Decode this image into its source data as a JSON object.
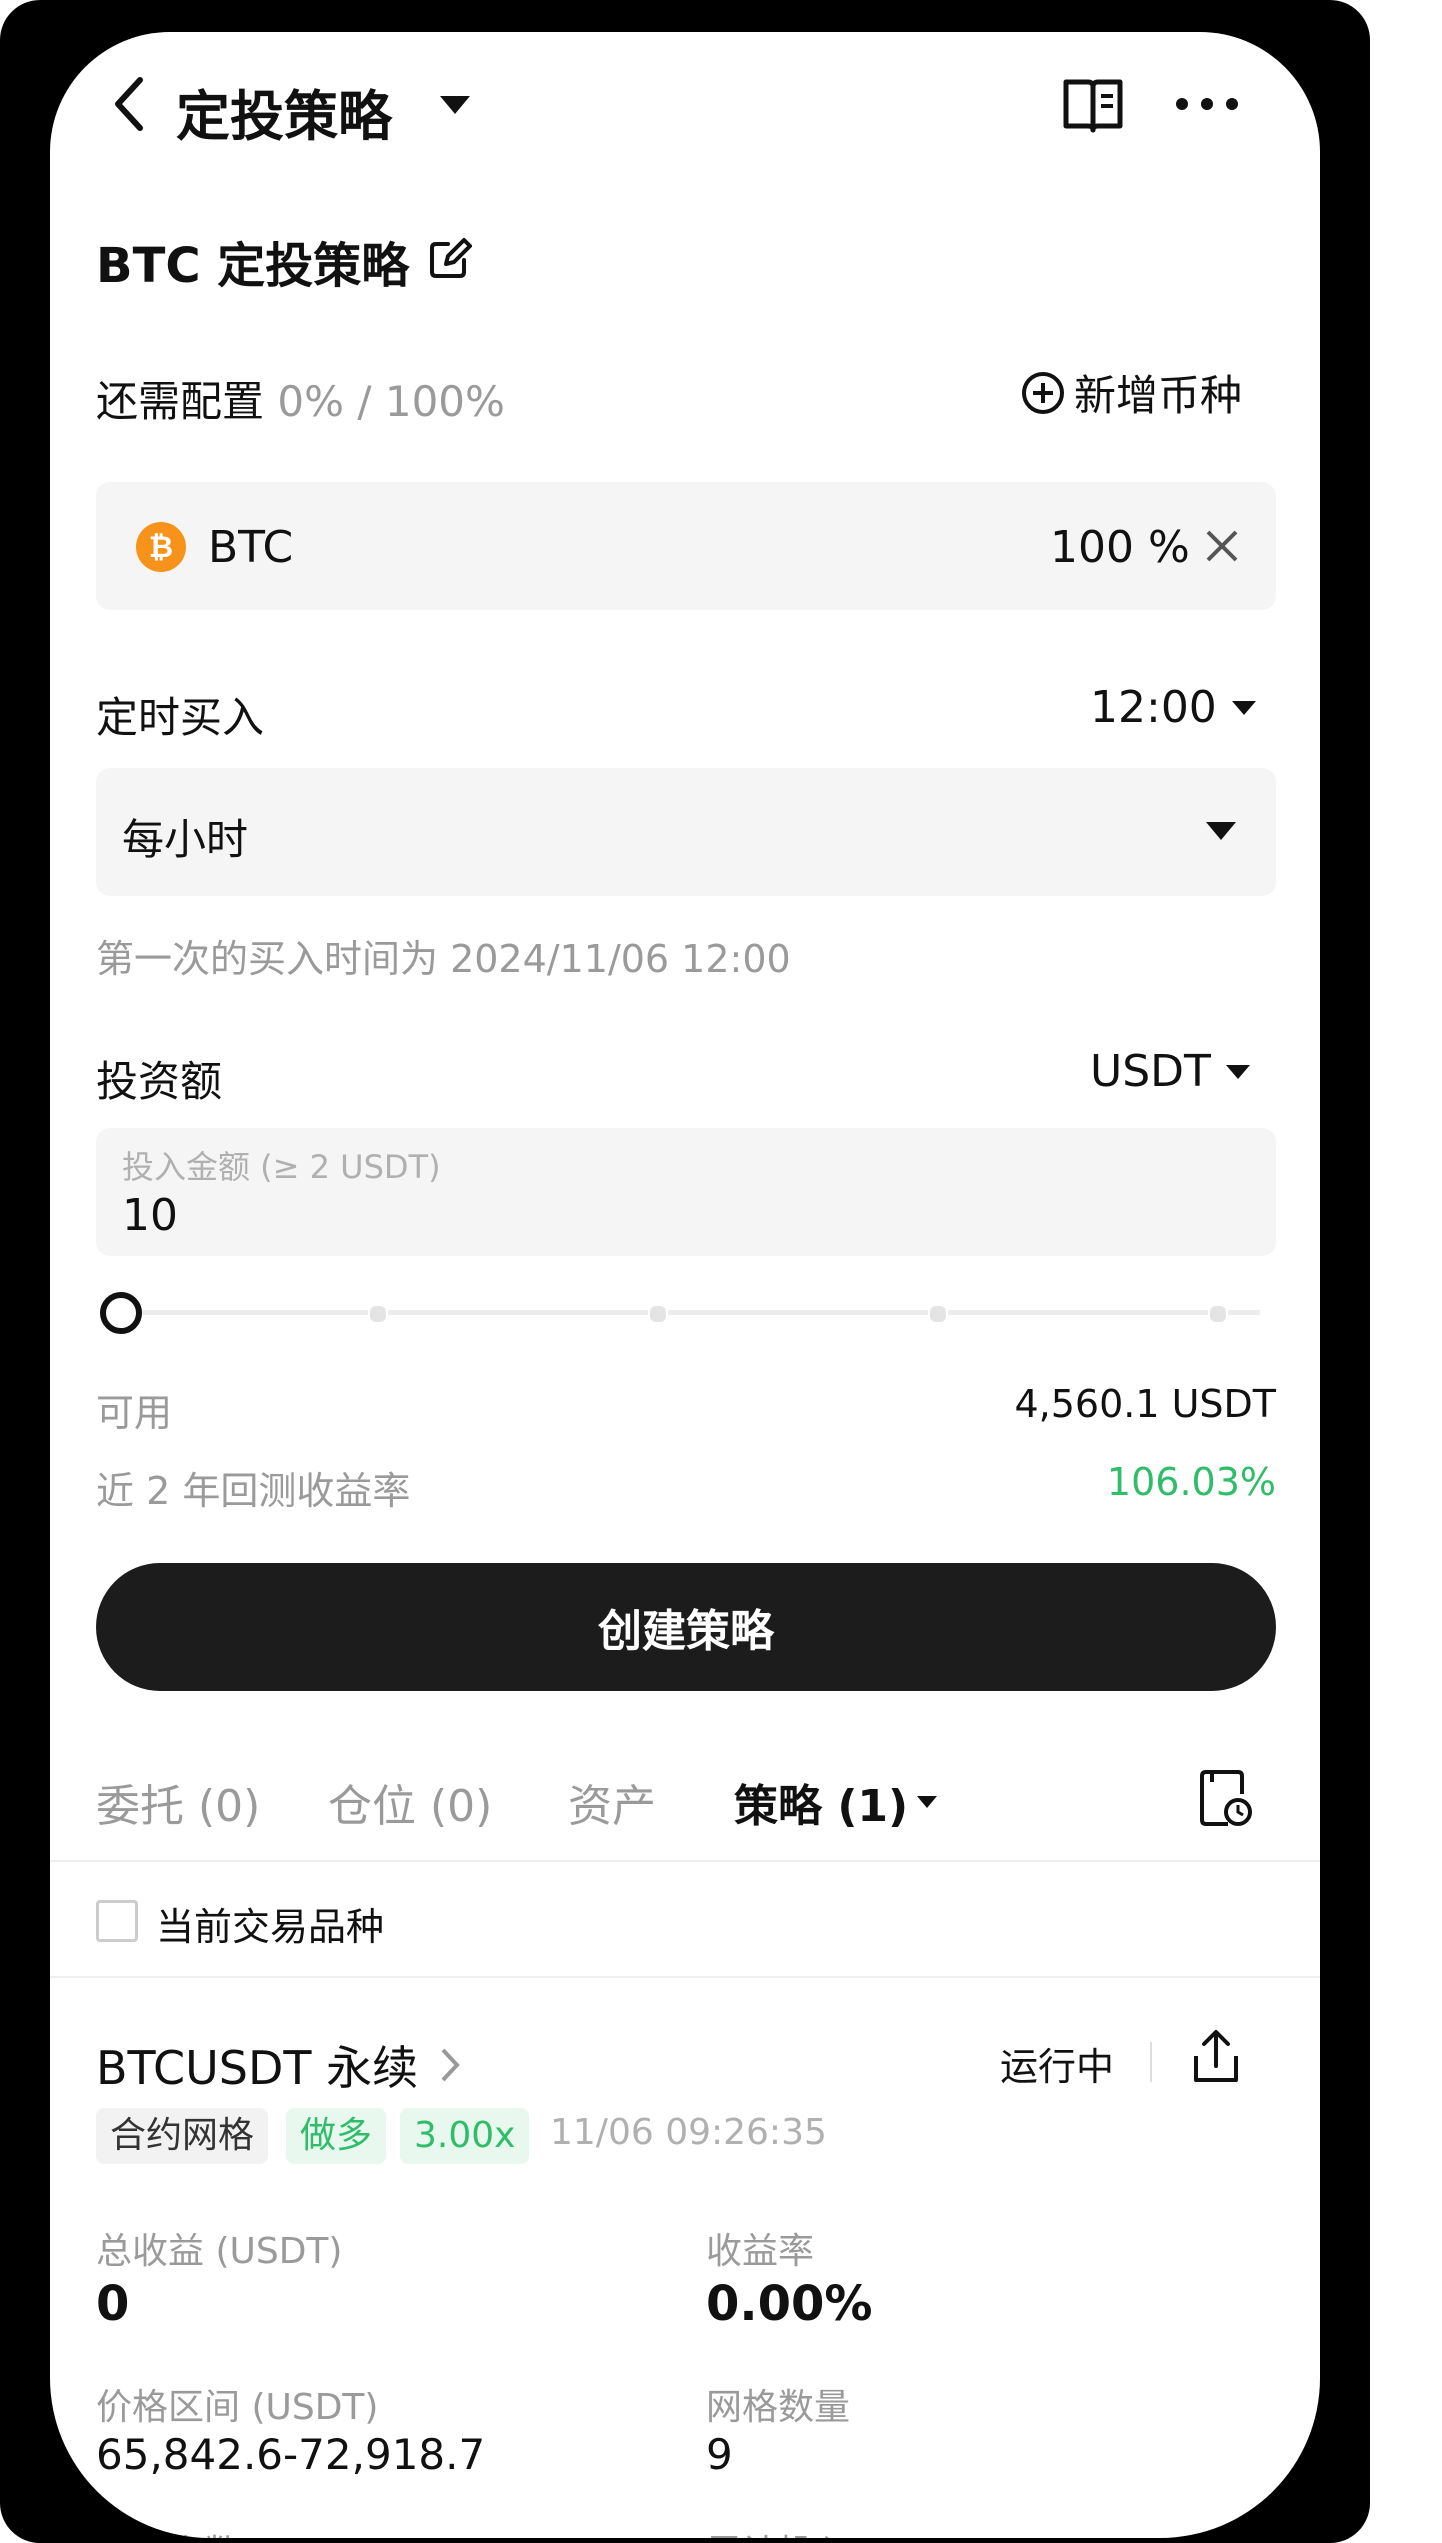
{
  "header": {
    "title": "定投策略",
    "book_icon": "book-icon",
    "more_icon": "more-icon"
  },
  "strategy": {
    "name": "BTC 定投策略"
  },
  "allocation": {
    "label": "还需配置",
    "value": "0% / 100%",
    "add_label": "新增币种",
    "coin": "BTC",
    "percent": "100 %"
  },
  "schedule": {
    "label": "定时买入",
    "time": "12:00",
    "frequency": "每小时",
    "first_buy_note": "第一次的买入时间为 2024/11/06 12:00"
  },
  "investment": {
    "label": "投资额",
    "currency": "USDT",
    "placeholder": "投入金额 (≥ 2 USDT)",
    "value": "10",
    "slider_percent": 0
  },
  "stats": {
    "available_label": "可用",
    "available_value": "4,560.1 USDT",
    "backtest_label": "近 2 年回测收益率",
    "backtest_value": "106.03%"
  },
  "create_button": "创建策略",
  "tabs": [
    {
      "label": "委托 (0)"
    },
    {
      "label": "仓位 (0)"
    },
    {
      "label": "资产"
    },
    {
      "label": "策略 (1)"
    }
  ],
  "filter": {
    "current_pair_label": "当前交易品种"
  },
  "position": {
    "symbol": "BTCUSDT 永续",
    "status": "运行中",
    "tags": [
      "合约网格",
      "做多",
      "3.00x"
    ],
    "timestamp": "11/06 09:26:35",
    "total_profit_label": "总收益 (USDT)",
    "total_profit_value": "0",
    "yield_label": "收益率",
    "yield_value": "0.00%",
    "range_label": "价格区间 (USDT)",
    "range_value": "65,842.6-72,918.7",
    "grid_label": "网格数量",
    "grid_value": "9",
    "arb_label": "套利次数",
    "invested_label": "累计投入 (USDT)"
  },
  "colors": {
    "accent_green": "#2fbd6a",
    "tag_green_bg": "#e8f8ee",
    "button_dark": "#1c1c1c",
    "btc_orange": "#f7931a"
  }
}
